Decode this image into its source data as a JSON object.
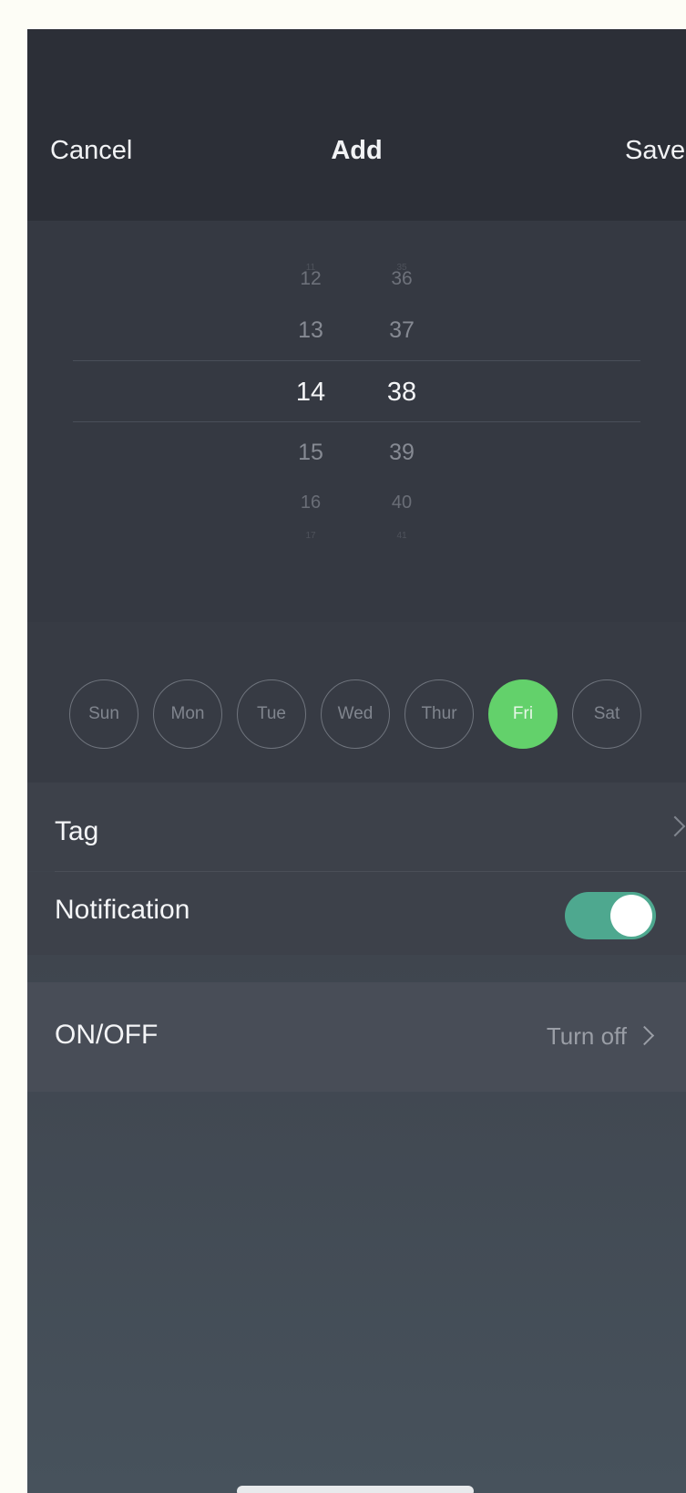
{
  "nav": {
    "cancel": "Cancel",
    "title": "Add",
    "save": "Save"
  },
  "time_picker": {
    "hours": [
      "12",
      "13",
      "14",
      "15",
      "16"
    ],
    "minutes": [
      "36",
      "37",
      "38",
      "39",
      "40"
    ],
    "selected_hour": "14",
    "selected_minute": "38"
  },
  "weekdays": {
    "days": [
      "Sun",
      "Mon",
      "Tue",
      "Wed",
      "Thur",
      "Fri",
      "Sat"
    ],
    "selected": "Fri"
  },
  "tag": {
    "label": "Tag",
    "icon": "chevron-right-icon"
  },
  "notification": {
    "label": "Notification",
    "enabled": true
  },
  "onoff": {
    "label": "ON/OFF",
    "value": "Turn off",
    "icon": "chevron-right-icon"
  },
  "colors": {
    "accent": "#63d16b",
    "toggle_on": "#4ea88f",
    "background": "#2c2f37"
  }
}
